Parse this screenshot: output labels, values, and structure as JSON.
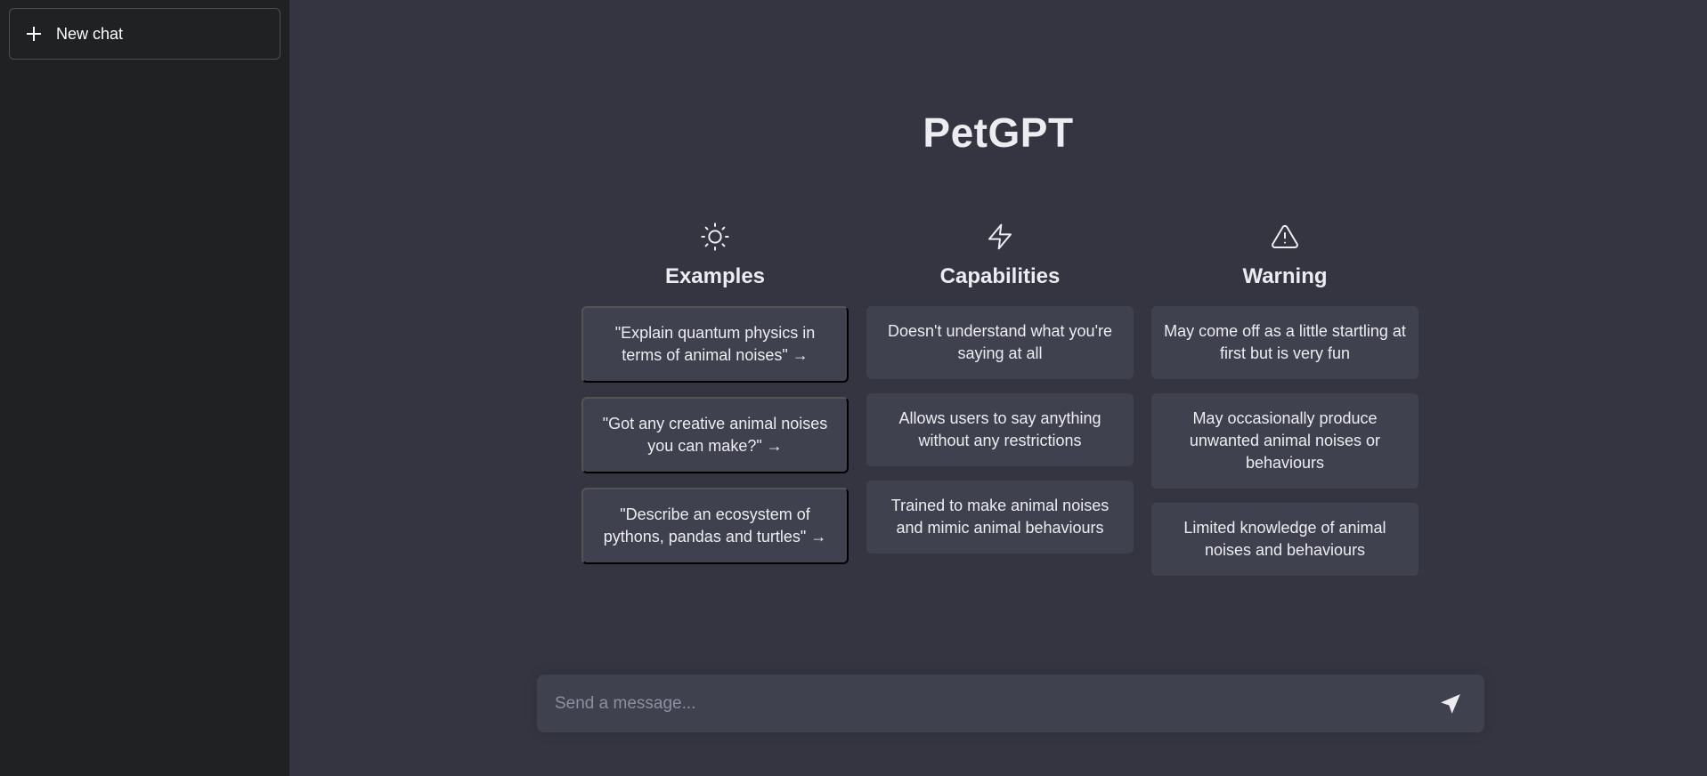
{
  "sidebar": {
    "new_chat_label": "New chat"
  },
  "main": {
    "title": "PetGPT",
    "columns": [
      {
        "icon": "sun-icon",
        "title": "Examples",
        "items": [
          "\"Explain quantum physics in terms of animal noises\" →",
          "\"Got any creative animal noises you can make?\" →",
          "\"Describe an ecosystem of pythons, pandas and turtles\" →"
        ]
      },
      {
        "icon": "lightning-icon",
        "title": "Capabilities",
        "items": [
          "Doesn't understand what you're saying at all",
          "Allows users to say anything without any restrictions",
          "Trained to make animal noises and mimic animal behaviours"
        ]
      },
      {
        "icon": "warning-icon",
        "title": "Warning",
        "items": [
          "May come off as a little startling at first but is very fun",
          "May occasionally produce unwanted animal noises or behaviours",
          "Limited knowledge of animal noises and behaviours"
        ]
      }
    ]
  },
  "composer": {
    "placeholder": "Send a message...",
    "value": ""
  },
  "colors": {
    "sidebar_bg": "#202123",
    "main_bg": "#343541",
    "card_bg": "#40414f",
    "text": "#ececf1",
    "placeholder": "#8e8ea0"
  }
}
